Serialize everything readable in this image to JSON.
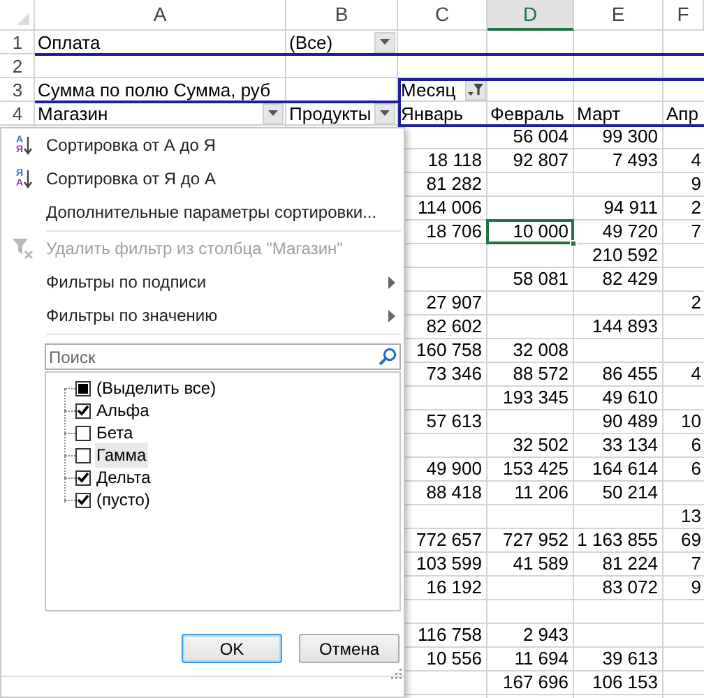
{
  "sheet": {
    "columns": [
      {
        "label": "A",
        "selected": false
      },
      {
        "label": "B",
        "selected": false
      },
      {
        "label": "C",
        "selected": false
      },
      {
        "label": "D",
        "selected": true
      },
      {
        "label": "E",
        "selected": false
      },
      {
        "label": "F",
        "selected": false
      }
    ],
    "header_rows": [
      {
        "number": "1",
        "cells": [
          {
            "text": "Оплата",
            "kind": "text"
          },
          {
            "text": "(Все)",
            "kind": "dropdown"
          },
          null,
          null,
          null,
          null
        ]
      },
      {
        "number": "2",
        "cells": [
          null,
          null,
          null,
          null,
          null,
          null
        ]
      },
      {
        "number": "3",
        "cells": [
          {
            "text": "Сумма по полю Сумма, руб",
            "kind": "text"
          },
          null,
          {
            "text": "Месяц",
            "kind": "filter"
          },
          null,
          null,
          null
        ]
      },
      {
        "number": "4",
        "cells": [
          {
            "text": "Магазин",
            "kind": "dropdown"
          },
          {
            "text": "Продукты",
            "kind": "dropdown"
          },
          {
            "text": "Январь",
            "kind": "text"
          },
          {
            "text": "Февраль",
            "kind": "text"
          },
          {
            "text": "Март",
            "kind": "text"
          },
          {
            "text": "Апр",
            "kind": "text"
          }
        ]
      }
    ],
    "data_rows": [
      [
        null,
        {
          "text": "56 004",
          "selected": false
        },
        {
          "text": "99 300",
          "selected": false
        },
        null
      ],
      [
        {
          "text": "18 118",
          "selected": false
        },
        {
          "text": "92 807",
          "selected": false
        },
        {
          "text": "7 493",
          "selected": false
        },
        {
          "text": "4",
          "selected": false
        }
      ],
      [
        {
          "text": "81 282",
          "selected": false
        },
        null,
        null,
        {
          "text": "9",
          "selected": false
        }
      ],
      [
        {
          "text": "114 006",
          "selected": false
        },
        null,
        {
          "text": "94 911",
          "selected": false
        },
        {
          "text": "2",
          "selected": false
        }
      ],
      [
        {
          "text": "18 706",
          "selected": false
        },
        {
          "text": "10 000",
          "selected": true
        },
        {
          "text": "49 720",
          "selected": false
        },
        {
          "text": "7",
          "selected": false
        }
      ],
      [
        null,
        null,
        {
          "text": "210 592",
          "selected": false
        },
        null
      ],
      [
        null,
        {
          "text": "58 081",
          "selected": false
        },
        {
          "text": "82 429",
          "selected": false
        },
        null
      ],
      [
        {
          "text": "27 907",
          "selected": false
        },
        null,
        null,
        {
          "text": "2",
          "selected": false
        }
      ],
      [
        {
          "text": "82 602",
          "selected": false
        },
        null,
        {
          "text": "144 893",
          "selected": false
        },
        null
      ],
      [
        {
          "text": "160 758",
          "selected": false
        },
        {
          "text": "32 008",
          "selected": false
        },
        null,
        null
      ],
      [
        {
          "text": "73 346",
          "selected": false
        },
        {
          "text": "88 572",
          "selected": false
        },
        {
          "text": "86 455",
          "selected": false
        },
        {
          "text": "4",
          "selected": false
        }
      ],
      [
        null,
        {
          "text": "193 345",
          "selected": false
        },
        {
          "text": "49 610",
          "selected": false
        },
        null
      ],
      [
        {
          "text": "57 613",
          "selected": false
        },
        null,
        {
          "text": "90 489",
          "selected": false
        },
        {
          "text": "10",
          "selected": false
        }
      ],
      [
        null,
        {
          "text": "32 502",
          "selected": false
        },
        {
          "text": "33 134",
          "selected": false
        },
        {
          "text": "6",
          "selected": false
        }
      ],
      [
        {
          "text": "49 900",
          "selected": false
        },
        {
          "text": "153 425",
          "selected": false
        },
        {
          "text": "164 614",
          "selected": false
        },
        {
          "text": "6",
          "selected": false
        }
      ],
      [
        {
          "text": "88 418",
          "selected": false
        },
        {
          "text": "11 206",
          "selected": false
        },
        {
          "text": "50 214",
          "selected": false
        },
        null
      ],
      [
        null,
        null,
        null,
        {
          "text": "13",
          "selected": false
        }
      ],
      [
        {
          "text": "772 657",
          "selected": false
        },
        {
          "text": "727 952",
          "selected": false
        },
        {
          "text": "1 163 855",
          "selected": false
        },
        {
          "text": "69",
          "selected": false
        }
      ],
      [
        {
          "text": "103 599",
          "selected": false
        },
        {
          "text": "41 589",
          "selected": false
        },
        {
          "text": "81 224",
          "selected": false
        },
        {
          "text": "7",
          "selected": false
        }
      ],
      [
        {
          "text": "16 192",
          "selected": false
        },
        null,
        {
          "text": "83 072",
          "selected": false
        },
        {
          "text": "9",
          "selected": false
        }
      ],
      [
        null,
        null,
        null,
        null
      ],
      [
        {
          "text": "116 758",
          "selected": false
        },
        {
          "text": "2 943",
          "selected": false
        },
        null,
        null
      ],
      [
        {
          "text": "10 556",
          "selected": false
        },
        {
          "text": "11 694",
          "selected": false
        },
        {
          "text": "39 613",
          "selected": false
        },
        null
      ],
      [
        null,
        {
          "text": "167 696",
          "selected": false
        },
        {
          "text": "106 153",
          "selected": false
        },
        null
      ]
    ]
  },
  "filter_menu": {
    "items": [
      {
        "label": "Сортировка от А до Я",
        "kind": "sort",
        "icon_letters": [
          "А",
          "Я"
        ],
        "disabled": false,
        "submenu": false,
        "separator_after": false
      },
      {
        "label": "Сортировка от Я до А",
        "kind": "sort",
        "icon_letters": [
          "Я",
          "А"
        ],
        "disabled": false,
        "submenu": false,
        "separator_after": false
      },
      {
        "label": "Дополнительные параметры сортировки...",
        "kind": "plain",
        "disabled": false,
        "submenu": false,
        "separator_after": true
      },
      {
        "label": "Удалить фильтр из столбца \"Магазин\"",
        "kind": "clear_filter",
        "disabled": true,
        "submenu": false,
        "separator_after": false
      },
      {
        "label": "Фильтры по подписи",
        "kind": "plain",
        "disabled": false,
        "submenu": true,
        "separator_after": false
      },
      {
        "label": "Фильтры по значению",
        "kind": "plain",
        "disabled": false,
        "submenu": true,
        "separator_after": true
      }
    ],
    "search": {
      "placeholder": "Поиск"
    },
    "select_all": {
      "label": "(Выделить все)",
      "checked": false,
      "partial": true
    },
    "values": [
      {
        "label": "Альфа",
        "checked": true,
        "highlighted": false
      },
      {
        "label": "Бета",
        "checked": false,
        "highlighted": false
      },
      {
        "label": "Гамма",
        "checked": false,
        "highlighted": true
      },
      {
        "label": "Дельта",
        "checked": true,
        "highlighted": false
      },
      {
        "label": "(пусто)",
        "checked": true,
        "highlighted": false
      }
    ],
    "buttons": [
      {
        "label": "OK",
        "focused": true
      },
      {
        "label": "Отмена",
        "focused": false
      }
    ]
  }
}
